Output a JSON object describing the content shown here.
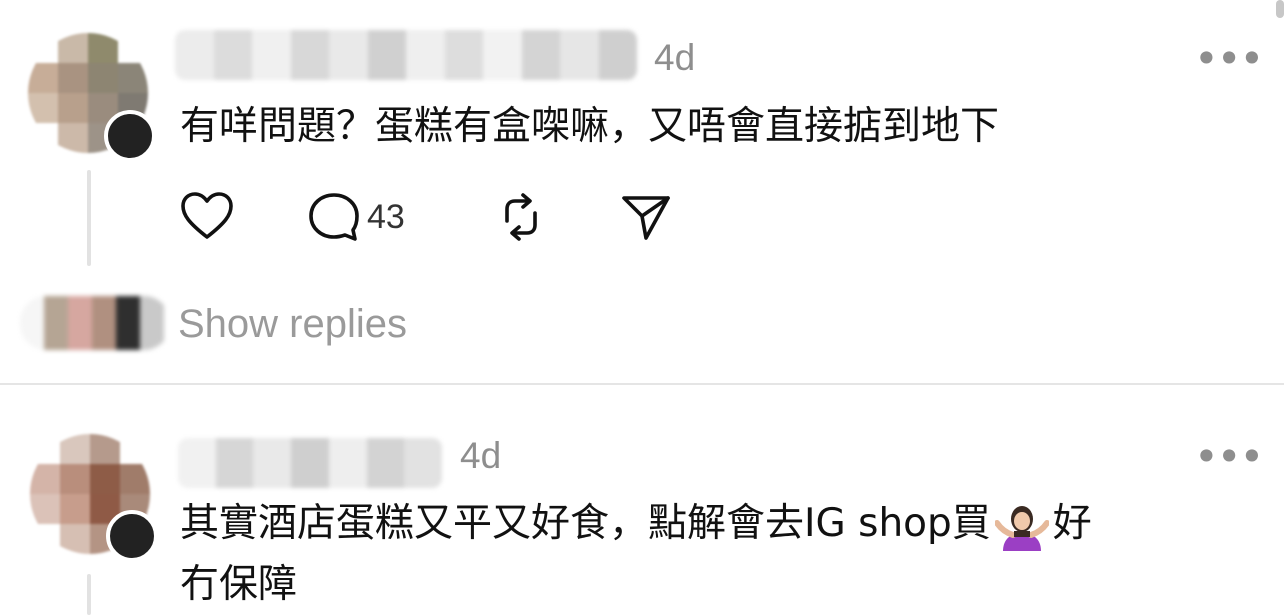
{
  "comments": [
    {
      "time": "4d",
      "text": "有咩問題？蛋糕有盒㗎嘛，又唔會直接掂到地下",
      "actions": {
        "reply_count": "43"
      },
      "show_replies_label": "Show replies"
    },
    {
      "time": "4d",
      "text_line1_before_emoji": "其實酒店蛋糕又平又好食，點解會去IG shop買",
      "emoji": "person-shrugging-emoji",
      "text_line1_after_emoji": "好",
      "text_line2": "冇保障"
    }
  ],
  "icons": {
    "like": "heart-icon",
    "comment": "comment-bubble-icon",
    "repost": "repost-icon",
    "share": "send-icon",
    "more": "more-options-icon"
  },
  "colors": {
    "secondary_text": "#8e8e8e",
    "divider": "#e5e5e5",
    "thread_line": "#e2e2e2"
  }
}
